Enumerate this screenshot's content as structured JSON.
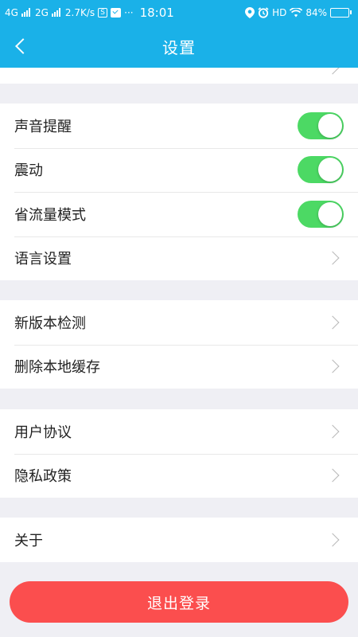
{
  "status_bar": {
    "network1": "4G",
    "network2": "2G",
    "speed": "2.7K/s",
    "s_badge": "S",
    "more": "···",
    "time": "18:01",
    "hd": "HD",
    "battery": "84%",
    "battery_level": 0.84,
    "icons": [
      "signal-icon",
      "mail-icon",
      "location-icon",
      "alarm-icon",
      "wifi-icon",
      "battery-icon"
    ]
  },
  "header": {
    "title": "设置"
  },
  "sections": {
    "group1": [
      {
        "label": "声音提醒",
        "control": "toggle",
        "on": true
      },
      {
        "label": "震动",
        "control": "toggle",
        "on": true
      },
      {
        "label": "省流量模式",
        "control": "toggle",
        "on": true
      },
      {
        "label": "语言设置",
        "control": "chevron"
      }
    ],
    "group2": [
      {
        "label": "新版本检测",
        "control": "chevron"
      },
      {
        "label": "删除本地缓存",
        "control": "chevron"
      }
    ],
    "group3": [
      {
        "label": "用户协议",
        "control": "chevron"
      },
      {
        "label": "隐私政策",
        "control": "chevron"
      }
    ],
    "group4": [
      {
        "label": "关于",
        "control": "chevron"
      }
    ]
  },
  "logout": {
    "label": "退出登录"
  },
  "colors": {
    "primary": "#1ab1e8",
    "toggle_on": "#4cd964",
    "logout": "#fb4e4e",
    "background": "#efeff4"
  }
}
